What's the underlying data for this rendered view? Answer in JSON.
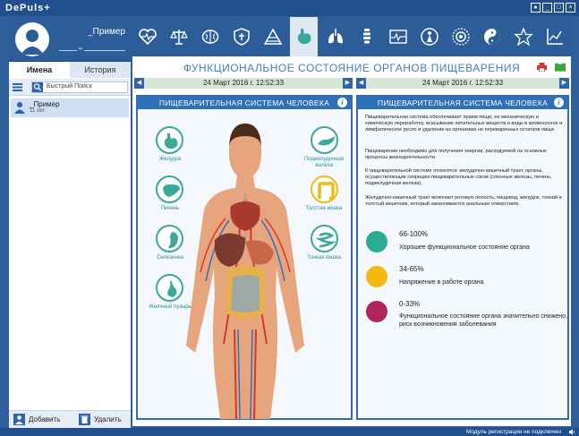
{
  "app": {
    "title": "DePuls+"
  },
  "profile": {
    "name": "_Пример",
    "age_marker": "∞"
  },
  "left_tabs": [
    {
      "label": "Имена"
    },
    {
      "label": "История"
    }
  ],
  "search": {
    "placeholder": "Быстрый Поиск"
  },
  "patients": [
    {
      "name": "_Пример",
      "age": "11 лет"
    }
  ],
  "left_bottom": {
    "add_label": "Добавить",
    "delete_label": "Удалить"
  },
  "categories": [
    "heart-icon",
    "scales-icon",
    "brain-icon",
    "shield-icon",
    "pyramid-icon",
    "stomach-icon",
    "lungs-icon",
    "spine-icon",
    "ecg-icon",
    "figure-icon",
    "sun-icon",
    "yin-yang-icon",
    "star-icon",
    "chart-icon"
  ],
  "active_category": 5,
  "header": {
    "title": "ФУНКЦИОНАЛЬНОЕ СОСТОЯНИЕ ОРГАНОВ ПИЩЕВАРЕНИЯ"
  },
  "dates": {
    "left": "24 Март 2016 г. 12:52:33",
    "right": "24 Март 2016 г. 12:52:33"
  },
  "left_panel": {
    "title": "ПИЩЕВАРИТЕЛЬНАЯ СИСТЕМА ЧЕЛОВЕКА",
    "organs": [
      {
        "label": "Желудок"
      },
      {
        "label": "Печень"
      },
      {
        "label": "Селезенка"
      },
      {
        "label": "Желчный пузырь"
      },
      {
        "label": "Поджелудочная железа"
      },
      {
        "label": "Толстая кишка"
      },
      {
        "label": "Тонкая кишка"
      }
    ]
  },
  "right_panel": {
    "title": "ПИЩЕВАРИТЕЛЬНАЯ СИСТЕМА ЧЕЛОВЕКА",
    "paragraphs": [
      "Пищеварительная система обеспечивает прием пищи, ее механическую и химическую переработку, всасывание питательных веществ и воды в кровеносное и лимфатическое русло и удаление из организма не переваренных остатков пищи.",
      "Пищеварение необходимо для получения энергии, расходуемой на основные процессы жизнедеятельности.",
      "К пищеварительной системе относятся: желудочно-кишечный тракт, органы, осуществляющие секрецию пищеварительных соков (слюнные железы, печень, поджелудочная железа).",
      "Желудочно-кишечный тракт включает ротовую полость, пищевод, желудок, тонкий и толстый кишечник, который заканчивается анальным отверстием."
    ],
    "legend": [
      {
        "range": "66-100%",
        "text": "Хорошее функциональное состояние органа",
        "color": "#2aab96"
      },
      {
        "range": "34-65%",
        "text": "Напряжение в работе органа",
        "color": "#f3b912"
      },
      {
        "range": "0-33%",
        "text": "Функциональное состояние органа значительно снижено, риск возникновения заболевания",
        "color": "#b0265c"
      }
    ]
  },
  "status": {
    "text": "Модуль регистрации не подключен"
  },
  "colors": {
    "accent": "#2f6fb5",
    "frame": "#2d5d99",
    "teal": "#3aa99c"
  }
}
